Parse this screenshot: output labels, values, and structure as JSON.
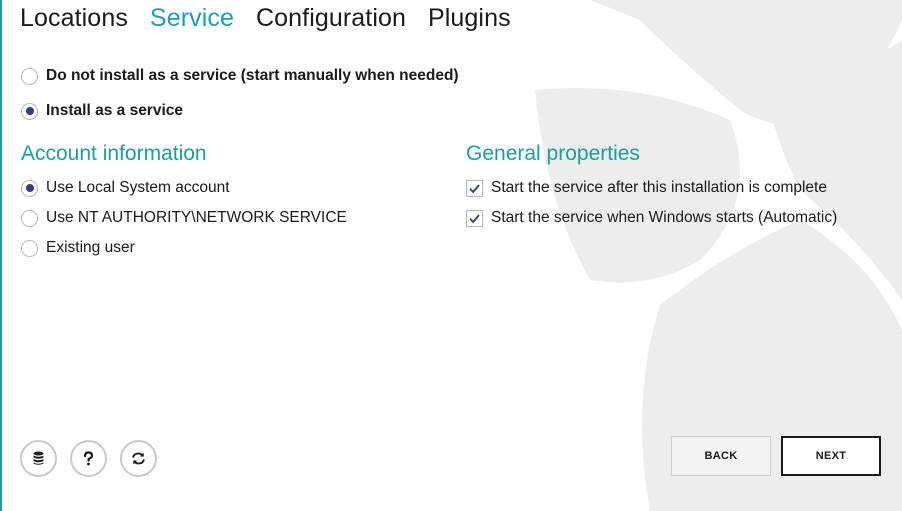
{
  "tabs": [
    {
      "label": "Locations",
      "active": false
    },
    {
      "label": "Service",
      "active": true
    },
    {
      "label": "Configuration",
      "active": false
    },
    {
      "label": "Plugins",
      "active": false
    }
  ],
  "install_mode": {
    "options": [
      {
        "label": "Do not install as a service (start manually when needed)",
        "selected": false
      },
      {
        "label": "Install as a service",
        "selected": true
      }
    ]
  },
  "account": {
    "title": "Account information",
    "options": [
      {
        "label": "Use Local System account",
        "selected": true
      },
      {
        "label": "Use NT AUTHORITY\\NETWORK SERVICE",
        "selected": false
      },
      {
        "label": "Existing user",
        "selected": false
      }
    ]
  },
  "general": {
    "title": "General properties",
    "options": [
      {
        "label": "Start the service after this installation is complete",
        "checked": true
      },
      {
        "label": "Start the service when Windows starts (Automatic)",
        "checked": true
      }
    ]
  },
  "toolbar": {
    "icons": [
      "database-icon",
      "help-icon",
      "refresh-icon"
    ]
  },
  "nav": {
    "back_label": "BACK",
    "next_label": "NEXT"
  },
  "colors": {
    "accent": "#1a9fb8",
    "section_title": "#1a9f9f",
    "radio_dot": "#2c3e8c",
    "watermark": "#ececec"
  }
}
